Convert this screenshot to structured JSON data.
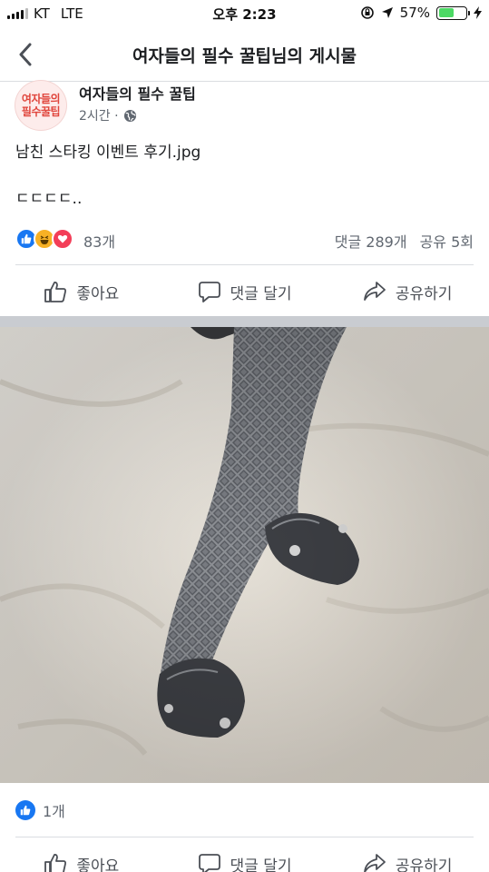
{
  "status_bar": {
    "carrier": "KT",
    "network": "LTE",
    "time": "오후 2:23",
    "battery": "57%",
    "battery_level": 0.57
  },
  "nav": {
    "title": "여자들의 필수 꿀팁님의 게시물"
  },
  "post": {
    "avatar_logo_text": [
      "여자들의",
      "필수꿀팁"
    ],
    "page_name": "여자들의 필수 꿀팁",
    "time_ago": "2시간 ·",
    "text_line1": "남친 스타킹 이벤트 후기.jpg",
    "text_line2": "ㄷㄷㄷㄷ..",
    "reaction_count": "83개",
    "comments": "댓글 289개",
    "shares": "공유 5회",
    "actions": {
      "like": "좋아요",
      "comment": "댓글 달기",
      "share": "공유하기"
    },
    "photo_likes": "1개"
  },
  "colors": {
    "facebook_blue": "#1877f2",
    "haha_yellow": "#f7b125",
    "love_red": "#f33e58",
    "battery_green": "#4cd964"
  }
}
